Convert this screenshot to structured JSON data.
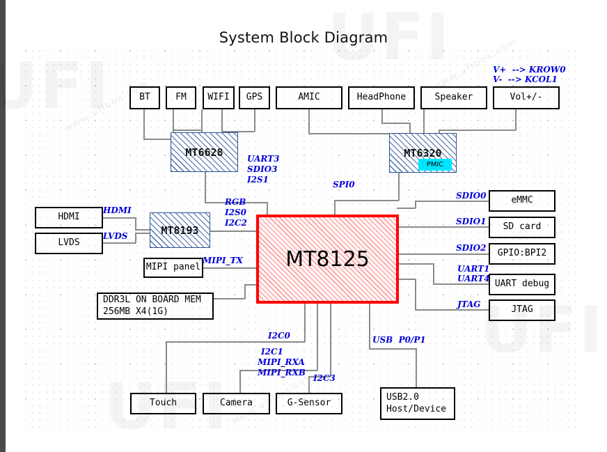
{
  "title": "System Block Diagram",
  "top_row": [
    {
      "id": "bt",
      "label": "BT"
    },
    {
      "id": "fm",
      "label": "FM"
    },
    {
      "id": "wifi",
      "label": "WIFI"
    },
    {
      "id": "gps",
      "label": "GPS"
    },
    {
      "id": "amic",
      "label": "AMIC"
    },
    {
      "id": "headphone",
      "label": "HeadPhone"
    },
    {
      "id": "speaker",
      "label": "Speaker"
    },
    {
      "id": "volume",
      "label": "Vol+/-"
    }
  ],
  "chips": {
    "combo": {
      "label": "MT6628"
    },
    "pmic": {
      "label": "MT6320",
      "tag": "PMIC"
    },
    "bridge": {
      "label": "MT8193"
    },
    "soc": {
      "label": "MT8125"
    }
  },
  "left_blocks": [
    {
      "id": "hdmi",
      "label": "HDMI"
    },
    {
      "id": "lvds",
      "label": "LVDS"
    },
    {
      "id": "mipi-panel",
      "label": "MIPI panel"
    },
    {
      "id": "ddr",
      "label": "DDR3L ON BOARD MEM\n256MB X4(1G)"
    }
  ],
  "right_blocks": [
    {
      "id": "emmc",
      "label": "eMMC"
    },
    {
      "id": "sd-card",
      "label": "SD card"
    },
    {
      "id": "gpio-bpi2",
      "label": "GPIO:BPI2"
    },
    {
      "id": "uart-debug",
      "label": "UART debug"
    },
    {
      "id": "jtag",
      "label": "JTAG"
    }
  ],
  "bottom_blocks": [
    {
      "id": "touch",
      "label": "Touch"
    },
    {
      "id": "camera",
      "label": "Camera"
    },
    {
      "id": "g-sensor",
      "label": "G-Sensor"
    },
    {
      "id": "usb",
      "label": "USB2.0\nHost/Device"
    }
  ],
  "net_labels": {
    "key_row": "V+  --> KROW0",
    "key_col": "V-  --> KCOL1",
    "uart3": "UART3",
    "sdio3": "SDIO3",
    "i2s1": "I2S1",
    "spi0": "SPI0",
    "rgb": "RGB",
    "i2s0": "I2S0",
    "i2c2": "I2C2",
    "hdmi": "HDMI",
    "lvds": "LVDS",
    "mipi_tx": "MIPI_TX",
    "sdio0": "SDIO0",
    "sdio1": "SDIO1",
    "sdio2": "SDIO2",
    "uart1": "UART1",
    "uart4": "UART4",
    "jtag": "JTAG",
    "i2c0": "I2C0",
    "i2c1": "I2C1",
    "mipi_rxa": "MIPI_RXA",
    "mipi_rxb": "MIPI_RXB",
    "i2c3": "I2C3",
    "usb_p0p1": "USB  P0/P1"
  },
  "watermark": {
    "brand": "UFI",
    "site": "www.ufibox.com"
  },
  "colors": {
    "soc_border": "#ff0000",
    "chip_border": "#2b4f8e",
    "net_text": "#0000d8",
    "pmic_tag": "#00e5ff",
    "wire": "#8a8a8a"
  }
}
